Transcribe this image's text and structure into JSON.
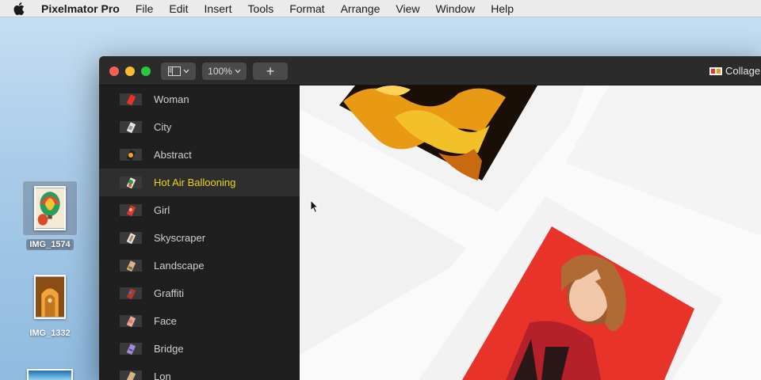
{
  "menubar": {
    "items": [
      {
        "label": "Pixelmator Pro",
        "name": "app-menu"
      },
      {
        "label": "File",
        "name": "menu-file"
      },
      {
        "label": "Edit",
        "name": "menu-edit"
      },
      {
        "label": "Insert",
        "name": "menu-insert"
      },
      {
        "label": "Tools",
        "name": "menu-tools"
      },
      {
        "label": "Format",
        "name": "menu-format"
      },
      {
        "label": "Arrange",
        "name": "menu-arrange"
      },
      {
        "label": "View",
        "name": "menu-view"
      },
      {
        "label": "Window",
        "name": "menu-window"
      },
      {
        "label": "Help",
        "name": "menu-help"
      }
    ]
  },
  "desktop": {
    "icons": [
      {
        "label": "IMG_1574",
        "selected": true
      },
      {
        "label": "IMG_1332",
        "selected": false
      }
    ]
  },
  "toolbar": {
    "zoom_label": "100%",
    "add_label": "+",
    "document_title": "Collage"
  },
  "sidebar": {
    "items": [
      {
        "label": "Woman",
        "icon": "red"
      },
      {
        "label": "City",
        "icon": "white"
      },
      {
        "label": "Abstract",
        "icon": "orange"
      },
      {
        "label": "Hot Air Ballooning",
        "icon": "multi",
        "active": true
      },
      {
        "label": "Girl",
        "icon": "red"
      },
      {
        "label": "Skyscraper",
        "icon": "white"
      },
      {
        "label": "Landscape",
        "icon": "tan"
      },
      {
        "label": "Graffiti",
        "icon": "red"
      },
      {
        "label": "Face",
        "icon": "pink"
      },
      {
        "label": "Bridge",
        "icon": "purple"
      },
      {
        "label": "Lon",
        "icon": "tan"
      }
    ]
  },
  "colors": {
    "active_text": "#e9d51e",
    "canvas_bg": "#fafafa",
    "photo_red": "#e8332a"
  }
}
